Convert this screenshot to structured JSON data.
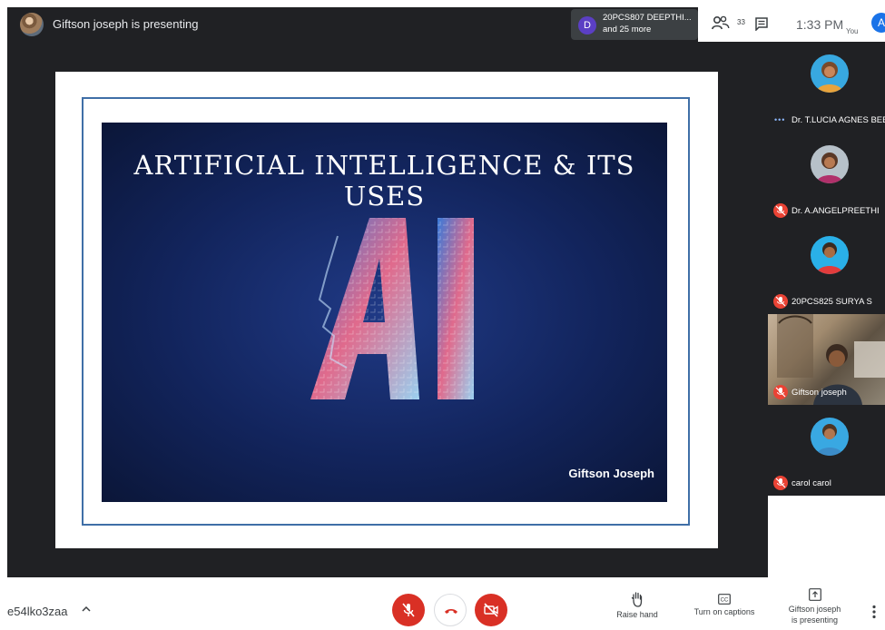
{
  "topbar": {
    "presenting_label": "Giftson joseph is presenting",
    "raise_hand_chip": {
      "initial": "D",
      "line1": "20PCS807 DEEPTHI...",
      "line2": "and 25 more"
    },
    "participant_count": "33",
    "time": "1:33 PM",
    "you_label": "You",
    "self_initial": "A"
  },
  "slide": {
    "title": "ARTIFICIAL INTELLIGENCE & ITS USES",
    "author": "Giftson Joseph"
  },
  "participants": [
    {
      "name": "Dr. T.LUCIA AGNES BEENA",
      "muted": false,
      "speaking_dots": "•••",
      "avatar_colors": [
        "#38a8e0",
        "#7a4a2a",
        "#e8a33c"
      ]
    },
    {
      "name": "Dr. A.ANGELPREETHI",
      "muted": true,
      "avatar_colors": [
        "#b7c1c9",
        "#5a3826",
        "#b0306a"
      ]
    },
    {
      "name": "20PCS825 SURYA S",
      "muted": true,
      "avatar_colors": [
        "#2ab0e8",
        "#3a2a20",
        "#e23c3c"
      ]
    },
    {
      "name": "Giftson joseph",
      "muted": true,
      "video": true
    },
    {
      "name": "carol carol",
      "muted": true,
      "avatar_colors": [
        "#39a8e2",
        "#4e3524",
        "#3c8cc8"
      ]
    }
  ],
  "bottombar": {
    "meeting_code": "e54lko3zaa",
    "raise_hand_label": "Raise hand",
    "captions_label": "Turn on captions",
    "present_label_line1": "Giftson joseph",
    "present_label_line2": "is presenting"
  },
  "colors": {
    "accent_red": "#d93025",
    "accent_blue": "#1a73e8",
    "dark_bg": "#202124"
  }
}
